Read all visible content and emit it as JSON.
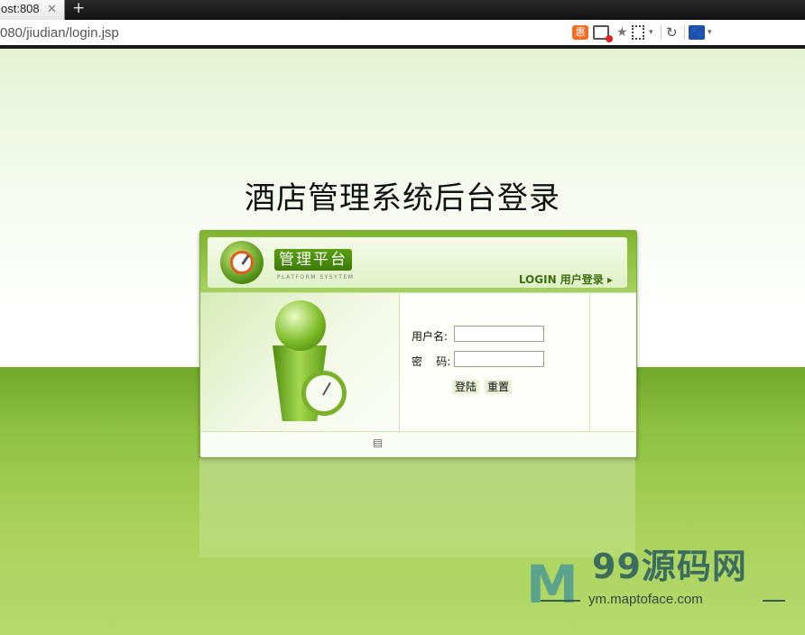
{
  "browser": {
    "tab_title": "ost:808",
    "close_glyph": "✕",
    "new_tab_glyph": "+",
    "url": "080/jiudian/login.jsp",
    "icons": [
      "extension-orange-icon",
      "window-block-icon",
      "star-icon",
      "qr-code-icon",
      "refresh-icon",
      "baidu-paw-icon"
    ],
    "orange_icon_glyph": "惠",
    "paw_icon_glyph": "🐾",
    "star_glyph": "★",
    "refresh_glyph": "↻",
    "caret_glyph": "▾"
  },
  "page": {
    "title": "酒店管理系统后台登录",
    "brand_label": "管理平台",
    "brand_sub": "PLATFORM SYSYTEM",
    "login_heading": "LOGIN 用户登录 ▸",
    "form": {
      "username_label": "用户名:",
      "username_value": "",
      "password_label": "密    码:",
      "password_value": "",
      "login_button": "登陆",
      "reset_button": "重置"
    },
    "colors": {
      "accent_green": "#6fa829",
      "dark_green": "#3d7a06"
    }
  },
  "watermark": {
    "logo_letter": "M",
    "title": "99源码网",
    "subtitle": "ym.maptoface.com"
  }
}
